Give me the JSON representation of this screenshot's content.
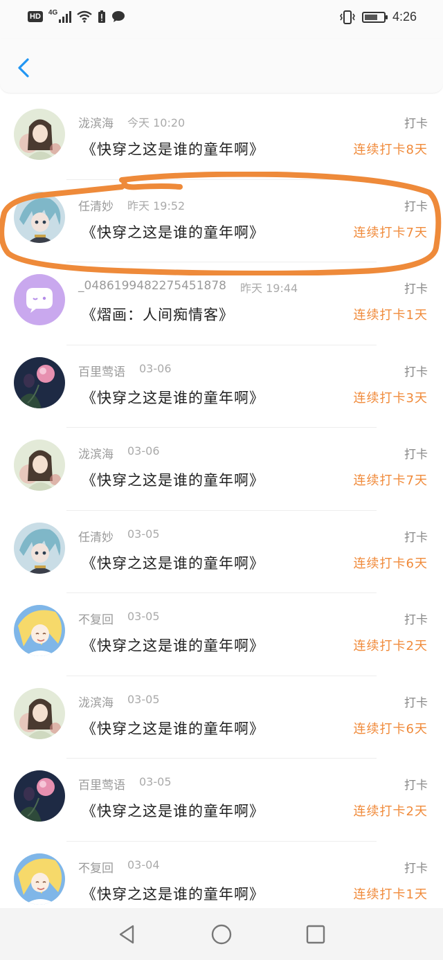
{
  "status_bar": {
    "hd": "HD",
    "network": "4G",
    "time": "4:26",
    "icons": [
      "hd-icon",
      "signal-icon",
      "wifi-icon",
      "battery-alert-icon",
      "message-icon",
      "vibrate-icon",
      "battery-icon"
    ]
  },
  "header": {
    "back_icon": "chevron-left-icon"
  },
  "records": [
    {
      "user": "泷滨海",
      "time": "今天 10:20",
      "book": "《快穿之这是谁的童年啊》",
      "kind": "打卡",
      "streak": "连续打卡8天",
      "avatar": "girl-green"
    },
    {
      "user": "任清妙",
      "time": "昨天 19:52",
      "book": "《快穿之这是谁的童年啊》",
      "kind": "打卡",
      "streak": "连续打卡7天",
      "avatar": "boy-teal"
    },
    {
      "user": "_0486199482275451878",
      "time": "昨天 19:44",
      "book": "《熠画：人间痴情客》",
      "kind": "打卡",
      "streak": "连续打卡1天",
      "avatar": "default-chat"
    },
    {
      "user": "百里莺语",
      "time": "03-06",
      "book": "《快穿之这是谁的童年啊》",
      "kind": "打卡",
      "streak": "连续打卡3天",
      "avatar": "dark-lotus"
    },
    {
      "user": "泷滨海",
      "time": "03-06",
      "book": "《快穿之这是谁的童年啊》",
      "kind": "打卡",
      "streak": "连续打卡7天",
      "avatar": "girl-green"
    },
    {
      "user": "任清妙",
      "time": "03-05",
      "book": "《快穿之这是谁的童年啊》",
      "kind": "打卡",
      "streak": "连续打卡6天",
      "avatar": "boy-teal"
    },
    {
      "user": "不复回",
      "time": "03-05",
      "book": "《快穿之这是谁的童年啊》",
      "kind": "打卡",
      "streak": "连续打卡2天",
      "avatar": "sunny-girl"
    },
    {
      "user": "泷滨海",
      "time": "03-05",
      "book": "《快穿之这是谁的童年啊》",
      "kind": "打卡",
      "streak": "连续打卡6天",
      "avatar": "girl-green"
    },
    {
      "user": "百里莺语",
      "time": "03-05",
      "book": "《快穿之这是谁的童年啊》",
      "kind": "打卡",
      "streak": "连续打卡2天",
      "avatar": "dark-lotus"
    },
    {
      "user": "不复回",
      "time": "03-04",
      "book": "《快穿之这是谁的童年啊》",
      "kind": "打卡",
      "streak": "连续打卡1天",
      "avatar": "sunny-girl"
    }
  ],
  "nav_bar": {
    "icons": [
      "back-triangle-icon",
      "home-circle-icon",
      "recents-square-icon"
    ]
  },
  "colors": {
    "accent": "#2196f3",
    "streak": "#f08a3a",
    "annotation": "#ee8a3a",
    "meta": "#9a9a9a"
  }
}
